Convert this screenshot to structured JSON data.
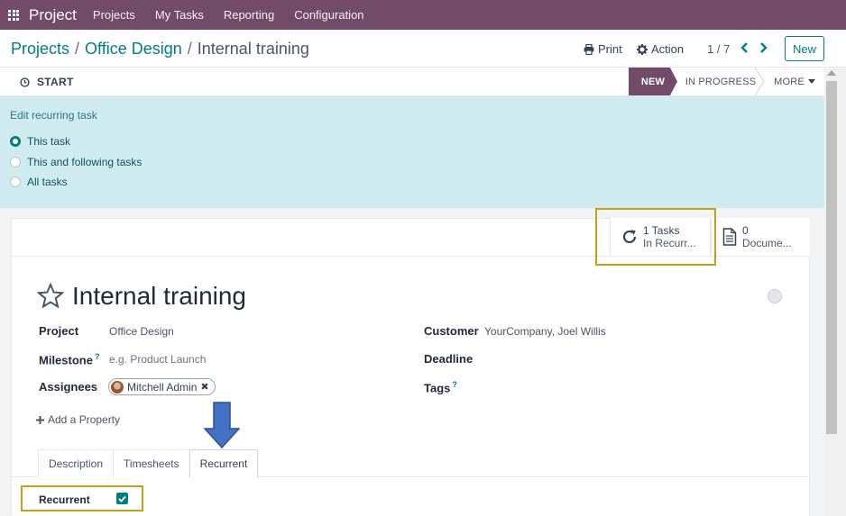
{
  "nav": {
    "app_name": "Project",
    "items": [
      "Projects",
      "My Tasks",
      "Reporting",
      "Configuration"
    ],
    "color": "#714b67"
  },
  "control_panel": {
    "breadcrumb": [
      "Projects",
      "Office Design",
      "Internal training"
    ],
    "print_label": "Print",
    "action_label": "Action",
    "pager": "1 / 7",
    "new_label": "New"
  },
  "statusbar": {
    "start_label": "START",
    "stages": {
      "new": "NEW",
      "in_progress": "IN PROGRESS",
      "more": "MORE"
    }
  },
  "recurring_banner": {
    "title": "Edit recurring task",
    "options": [
      {
        "label": "This task",
        "checked": true
      },
      {
        "label": "This and following tasks",
        "checked": false
      },
      {
        "label": "All tasks",
        "checked": false
      }
    ]
  },
  "smart_buttons": {
    "tasks": {
      "value": "1 Tasks",
      "label": "In Recurr..."
    },
    "documents": {
      "value": "0",
      "label": "Docume..."
    }
  },
  "form": {
    "title": "Internal training",
    "project_label": "Project",
    "project_value": "Office Design",
    "milestone_label": "Milestone",
    "milestone_placeholder": "e.g. Product Launch",
    "assignees_label": "Assignees",
    "assignee": "Mitchell Admin",
    "customer_label": "Customer",
    "customer_value": "YourCompany, Joel Willis",
    "deadline_label": "Deadline",
    "tags_label": "Tags",
    "help_mark": "?",
    "add_property": "Add a Property"
  },
  "tabs": [
    "Description",
    "Timesheets",
    "Recurrent"
  ],
  "recurrent": {
    "label": "Recurrent",
    "checked": true
  },
  "colors": {
    "accent": "#017e84",
    "highlight": "#c4a11b",
    "banner": "#d1ecf1",
    "arrow": "#4472c4"
  }
}
